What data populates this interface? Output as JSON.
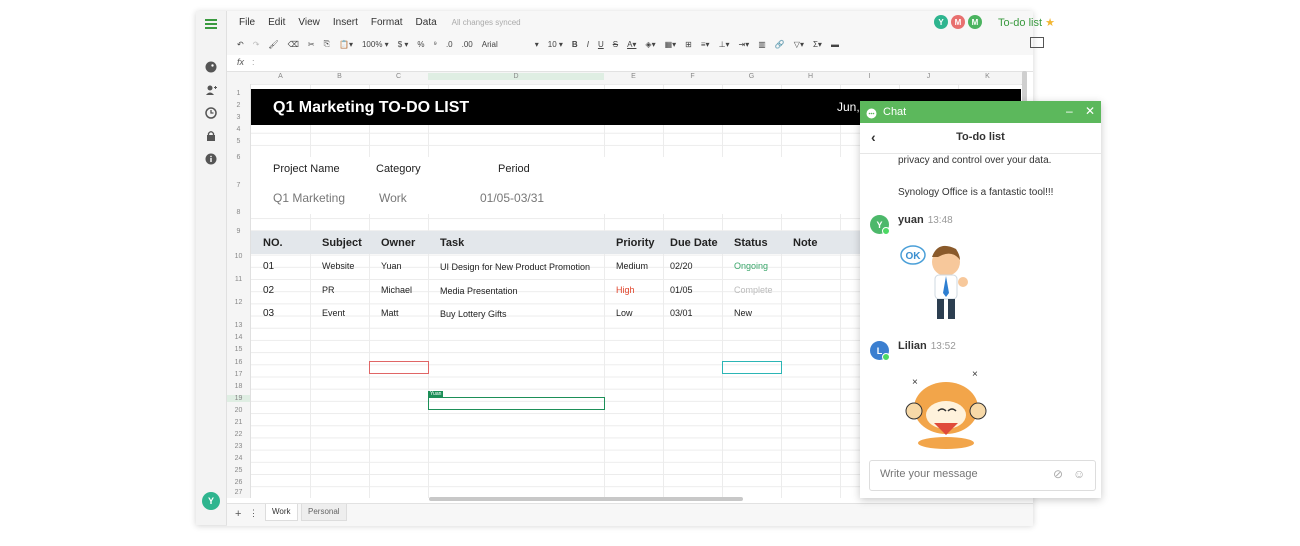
{
  "menu": [
    "File",
    "Edit",
    "View",
    "Insert",
    "Format",
    "Data"
  ],
  "sync_status": "All changes synced",
  "toolbar": {
    "zoom": "100%",
    "currency": "$",
    "percent": "%",
    "dec_dec": ".0",
    "dec_inc": ".00",
    "font": "Arial",
    "size": "10"
  },
  "collaborators": [
    {
      "initial": "Y",
      "color": "#2fb58f"
    },
    {
      "initial": "M",
      "color": "#e8706f"
    },
    {
      "initial": "M",
      "color": "#4bb35f"
    }
  ],
  "doc_title": "To-do list",
  "fx_label": "fx",
  "columns": [
    "A",
    "B",
    "C",
    "D",
    "E",
    "F",
    "G",
    "H",
    "I",
    "J",
    "K"
  ],
  "rows": [
    "1",
    "2",
    "3",
    "4",
    "5",
    "6",
    "7",
    "8",
    "9",
    "10",
    "11",
    "12",
    "13",
    "14",
    "15",
    "16",
    "17",
    "18",
    "19",
    "20",
    "21",
    "22",
    "23",
    "24",
    "25",
    "26",
    "27"
  ],
  "sheet": {
    "title": "Q1 Marketing TO-DO LIST",
    "date": "Jun,",
    "project_label": "Project Name",
    "category_label": "Category",
    "period_label": "Period",
    "project_value": "Q1 Marketing",
    "category_value": "Work",
    "period_value": "01/05-03/31",
    "headers": [
      "NO.",
      "Subject",
      "Owner",
      "Task",
      "Priority",
      "Due Date",
      "Status",
      "Note"
    ],
    "tasks": [
      {
        "no": "01",
        "subject": "Website",
        "owner": "Yuan",
        "task": "UI Design for New Product Promotion",
        "priority": "Medium",
        "due": "02/20",
        "status": "Ongoing"
      },
      {
        "no": "02",
        "subject": "PR",
        "owner": "Michael",
        "task": "Media Presentation",
        "priority": "High",
        "due": "01/05",
        "status": "Complete"
      },
      {
        "no": "03",
        "subject": "Event",
        "owner": "Matt",
        "task": "Buy Lottery Gifts",
        "priority": "Low",
        "due": "03/01",
        "status": "New"
      }
    ],
    "cursor_label": "Yuan"
  },
  "tabs": [
    {
      "label": "Work",
      "active": true
    },
    {
      "label": "Personal",
      "active": false
    }
  ],
  "user_avatar": "Y",
  "chat": {
    "header": "Chat",
    "conversation": "To-do list",
    "prev_lines": [
      "privacy and control over your data.",
      "Synology Office is a fantastic tool!!!"
    ],
    "messages": [
      {
        "initial": "Y",
        "name": "yuan",
        "time": "13:48",
        "color": "#4cb86a"
      },
      {
        "initial": "L",
        "name": "Lilian",
        "time": "13:52",
        "color": "#3b7fd0"
      }
    ],
    "sticker_text": "OK",
    "input_placeholder": "Write your message"
  },
  "colors": {
    "accent": "#5cb85c",
    "ongoing": "#3aa66a",
    "high": "#e0442b",
    "complete": "#bbbbbb"
  }
}
